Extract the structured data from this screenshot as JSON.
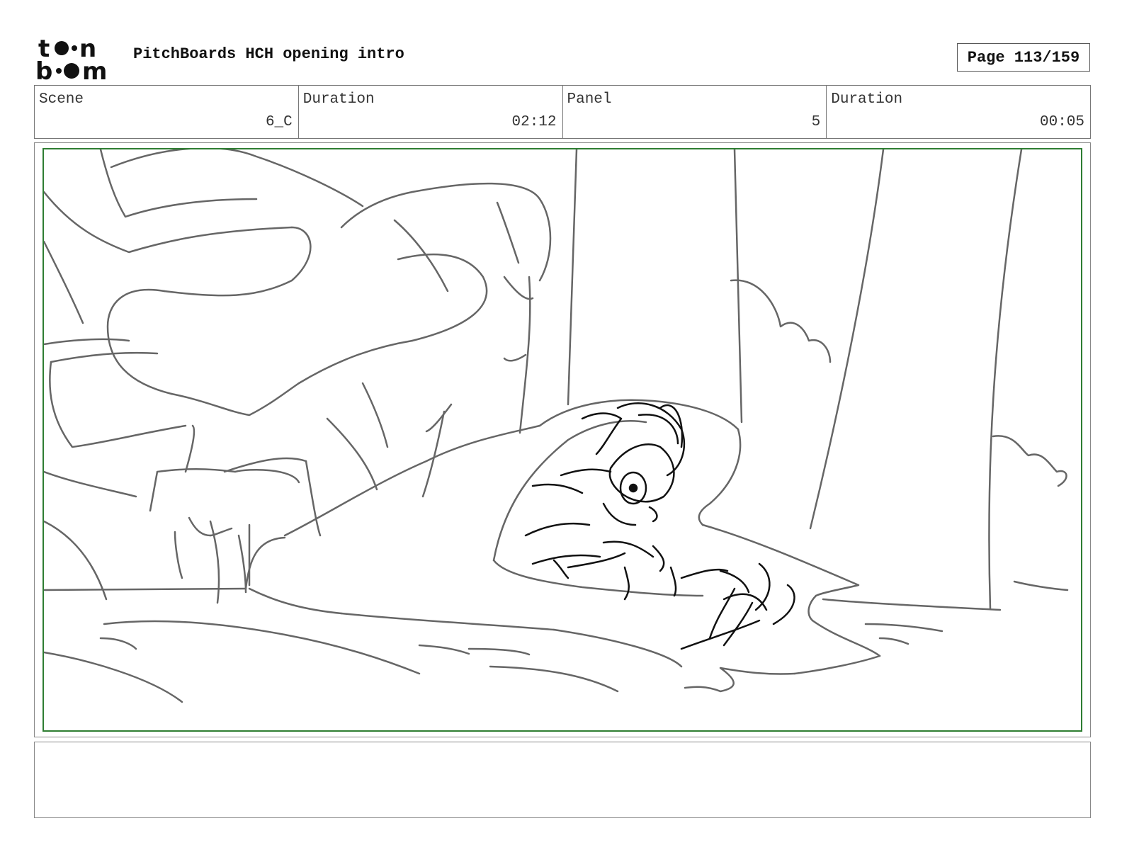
{
  "header": {
    "logo_text": "toon boom",
    "title": "PitchBoards HCH opening intro",
    "page_label": "Page 113/159"
  },
  "info": [
    {
      "label": "Scene",
      "value": "6_C"
    },
    {
      "label": "Duration",
      "value": "02:12"
    },
    {
      "label": "Panel",
      "value": "5"
    },
    {
      "label": "Duration",
      "value": "00:05"
    }
  ],
  "panel": {
    "frame_color": "#2e7d32",
    "sketch_color": "#666666",
    "character_color": "#111111"
  },
  "notes": {
    "text": ""
  }
}
